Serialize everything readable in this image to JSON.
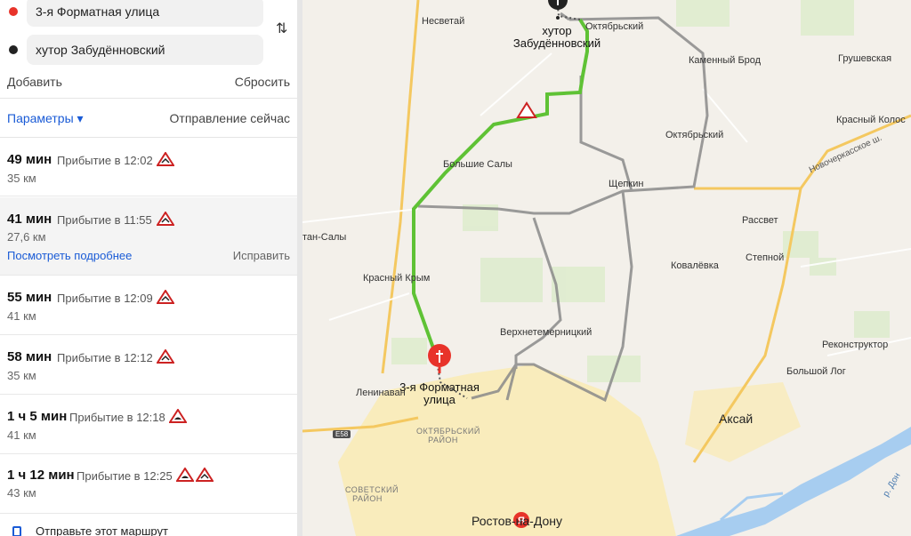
{
  "search": {
    "from": "3-я Форматная улица",
    "to": "хутор Забудённовский",
    "add_label": "Добавить",
    "reset_label": "Сбросить"
  },
  "options": {
    "params_label": "Параметры ▾",
    "departure_label": "Отправление сейчас"
  },
  "routes": [
    {
      "time": "49 мин",
      "arrival": "Прибытие в 12:02",
      "distance": "35 км"
    },
    {
      "time": "41 мин",
      "arrival": "Прибытие в 11:55",
      "distance": "27,6 км",
      "details_label": "Посмотреть подробнее",
      "fix_label": "Исправить"
    },
    {
      "time": "55 мин",
      "arrival": "Прибытие в 12:09",
      "distance": "41 км"
    },
    {
      "time": "58 мин",
      "arrival": "Прибытие в 12:12",
      "distance": "35 км"
    },
    {
      "time": "1 ч 5 мин",
      "arrival": "Прибытие в 12:18",
      "distance": "41 км"
    },
    {
      "time": "1 ч 12 мин",
      "arrival": "Прибытие в 12:25",
      "distance": "43 км"
    }
  ],
  "share_label": "Отправьте этот маршрут",
  "map": {
    "labels": {
      "nesvetay": "Несветай",
      "oktyabrsky_n": "Октябрьский",
      "kamenny_brod": "Каменный Брод",
      "grushevskaya": "Грушевская",
      "krasny_kolos": "Красный Колос",
      "oktyabrsky": "Октябрьский",
      "novocherkasskoe": "Новочеркасское ш.",
      "bolshie_saly": "Большие Салы",
      "schepkin": "Щепкин",
      "rassvet": "Рассвет",
      "sultan_saly": "тан-Салы",
      "kovalevka": "Ковалёвка",
      "stepnoy": "Степной",
      "krasny_krym": "Красный Крым",
      "verkhnetemernitsky": "Верхнетемерницкий",
      "rekonstruktor": "Реконструктор",
      "bolshoy_log": "Большой Лог",
      "leninavan": "Ленинаван",
      "aksay": "Аксай",
      "oktyabrsky_rayon": "ОКТЯБРЬСКИЙ РАЙОН",
      "sovetsky_rayon": "СОВЕТСКИЙ РАЙОН",
      "rostov": "Ростов-на-Дону",
      "r_don": "р. Дон",
      "highway": "E58"
    },
    "start_label": "3-я Форматная улица",
    "end_label": "хутор Забудённовский",
    "colors": {
      "route_primary": "#5fc235",
      "route_alt": "#8a8a8a",
      "start_pin": "#e8332a",
      "end_pin": "#222222",
      "water": "#a7cdf0",
      "city": "#fbe9a8",
      "fields": "#dceccb"
    }
  }
}
